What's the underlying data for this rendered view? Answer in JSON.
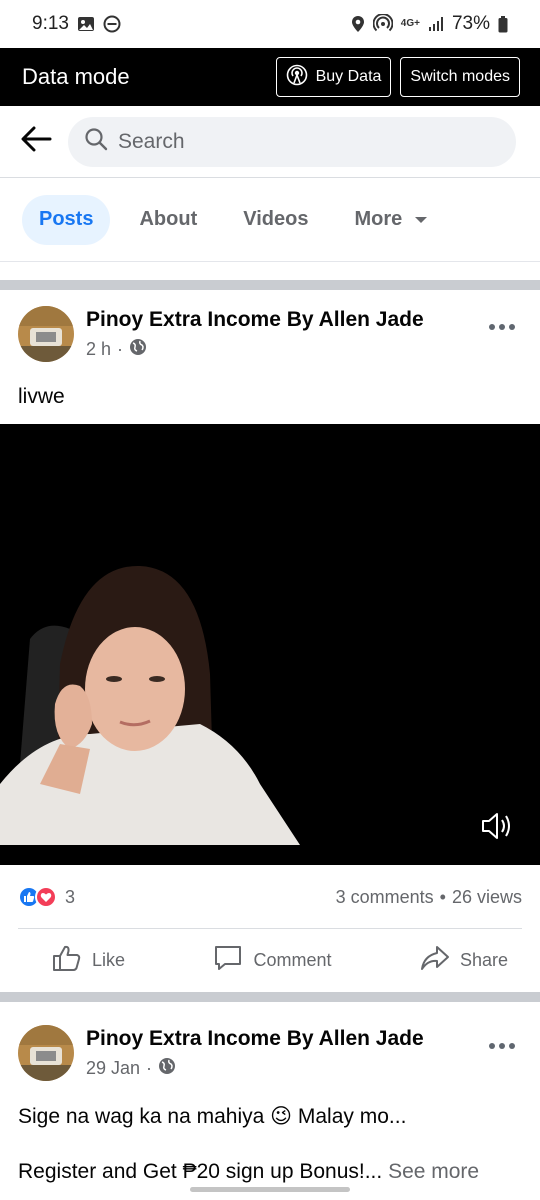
{
  "status_bar": {
    "time": "9:13",
    "network": "4G+",
    "battery": "73%"
  },
  "data_mode_bar": {
    "title": "Data mode",
    "buy_data_label": "Buy Data",
    "switch_modes_label": "Switch modes"
  },
  "search": {
    "placeholder": "Search"
  },
  "tabs": [
    {
      "label": "Posts",
      "active": true
    },
    {
      "label": "About",
      "active": false
    },
    {
      "label": "Videos",
      "active": false
    },
    {
      "label": "More",
      "active": false
    }
  ],
  "posts": [
    {
      "author": "Pinoy Extra Income By Allen Jade",
      "time": "2 h",
      "text": "livwe",
      "reaction_count": "3",
      "comments": "3 comments",
      "views": "26 views"
    },
    {
      "author": "Pinoy Extra Income By Allen Jade",
      "time": "29 Jan",
      "text": "Sige na wag ka na mahiya 😉 Malay mo...",
      "text2": "Register and Get ₱20 sign up Bonus!...",
      "see_more": "See more"
    }
  ],
  "actions": {
    "like": "Like",
    "comment": "Comment",
    "share": "Share"
  },
  "separators": {
    "time_dot": "·",
    "stats_dot": "•"
  },
  "colors": {
    "brand_blue": "#1877f2",
    "active_tab_bg": "#e7f3ff",
    "muted_text": "#65676b",
    "love_red": "#f33e58"
  },
  "icons": [
    "image-icon",
    "dnd-icon",
    "location-icon",
    "hotspot-icon",
    "signal-icon",
    "battery-icon",
    "broadcast-icon",
    "back-arrow-icon",
    "search-icon",
    "caret-down-icon",
    "globe-icon",
    "more-icon",
    "volume-icon",
    "like-reaction-icon",
    "love-reaction-icon",
    "thumb-up-icon",
    "comment-icon",
    "share-icon"
  ]
}
